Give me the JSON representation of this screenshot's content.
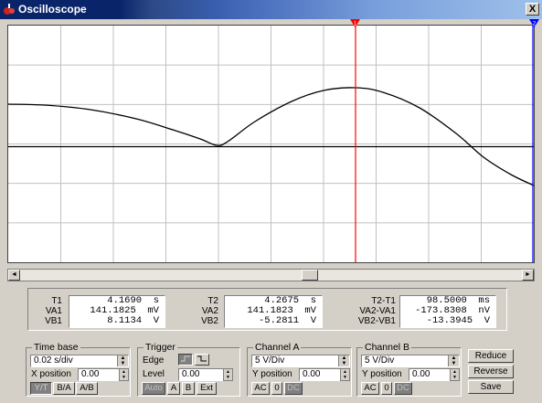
{
  "window": {
    "title": "Oscilloscope",
    "close_label": "X"
  },
  "cursors": {
    "t1_label": "1",
    "t2_label": "2"
  },
  "readout": {
    "col1": {
      "labels": [
        "T1",
        "VA1",
        "VB1"
      ],
      "values": [
        "4.1690  s",
        "141.1825  mV",
        "8.1134  V"
      ]
    },
    "col2": {
      "labels": [
        "T2",
        "VA2",
        "VB2"
      ],
      "values": [
        "4.2675  s",
        "141.1823  mV",
        "-5.2811  V"
      ]
    },
    "col3": {
      "labels": [
        "T2-T1",
        "VA2-VA1",
        "VB2-VB1"
      ],
      "values": [
        "98.5000  ms",
        "-173.8308  nV",
        "-13.3945  V"
      ]
    }
  },
  "timebase": {
    "title": "Time base",
    "scale": "0.02 s/div",
    "xpos_label": "X position",
    "xpos": "0.00",
    "modes": [
      "Y/T",
      "B/A",
      "A/B"
    ]
  },
  "trigger": {
    "title": "Trigger",
    "edge_label": "Edge",
    "level_label": "Level",
    "level": "0.00",
    "sources": [
      "Auto",
      "A",
      "B",
      "Ext"
    ]
  },
  "channel_a": {
    "title": "Channel A",
    "scale": "5 V/Div",
    "ypos_label": "Y position",
    "ypos": "0.00",
    "coupling": [
      "AC",
      "0",
      "DC"
    ]
  },
  "channel_b": {
    "title": "Channel B",
    "scale": "5 V/Div",
    "ypos_label": "Y position",
    "ypos": "0.00",
    "coupling": [
      "AC",
      "0",
      "DC"
    ]
  },
  "buttons": {
    "reduce": "Reduce",
    "reverse": "Reverse",
    "save": "Save"
  },
  "colors": {
    "cursor1": "#ff0000",
    "cursor2": "#0000ff",
    "trace": "#000000",
    "grid": "#c0c0c0"
  }
}
